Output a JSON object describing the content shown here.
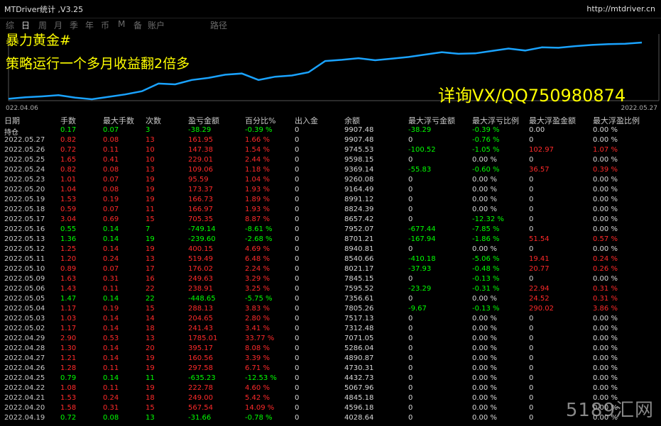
{
  "window": {
    "title": "MTDriver统计 ,V3.25",
    "url": "http://mtdriver.cn"
  },
  "tabs": [
    "综",
    "日",
    "周",
    "月",
    "季",
    "年",
    "币",
    "M",
    "备",
    "账户",
    "路径"
  ],
  "active_tab": 1,
  "chart": {
    "overlay1": "暴力黄金#",
    "overlay2": "策略运行一个多月收益翻2倍多",
    "overlay3": "详询VX/QQ750980874",
    "date_start": "022.04.06",
    "date_end": "2022.05.27",
    "line_color": "#1aa3ff",
    "values": [
      0,
      4,
      6,
      9,
      3,
      -1,
      5,
      11,
      19,
      38,
      36,
      47,
      52,
      60,
      63,
      47,
      55,
      58,
      66,
      94,
      97,
      101,
      96,
      100,
      104,
      110,
      116,
      112,
      113,
      119,
      125,
      120,
      128,
      127,
      131,
      134,
      136,
      137,
      140
    ]
  },
  "table": {
    "headers": [
      "日期",
      "手数",
      "最大手数",
      "次数",
      "盈亏金额",
      "百分比%",
      "出入金",
      "余额",
      "最大浮亏金额",
      "最大浮亏比例",
      "最大浮盈金额",
      "最大浮盈比例"
    ],
    "rows": [
      [
        "持仓",
        "0.17",
        "0.07",
        "3",
        "-38.29",
        "-0.39 %",
        "0",
        "9907.48",
        "-38.29",
        "-0.39 %",
        "0.00",
        "0.00 %"
      ],
      [
        "2022.05.27",
        "0.82",
        "0.08",
        "13",
        "161.95",
        "1.66 %",
        "0",
        "9907.48",
        "0",
        "-0.76 %",
        "0",
        "0.00 %"
      ],
      [
        "2022.05.26",
        "0.72",
        "0.11",
        "10",
        "147.38",
        "1.54 %",
        "0",
        "9745.53",
        "-100.52",
        "-1.05 %",
        "102.97",
        "1.07 %"
      ],
      [
        "2022.05.25",
        "1.65",
        "0.41",
        "10",
        "229.01",
        "2.44 %",
        "0",
        "9598.15",
        "0",
        "0.00 %",
        "0",
        "0.00 %"
      ],
      [
        "2022.05.24",
        "0.82",
        "0.08",
        "13",
        "109.06",
        "1.18 %",
        "0",
        "9369.14",
        "-55.83",
        "-0.60 %",
        "36.57",
        "0.39 %"
      ],
      [
        "2022.05.23",
        "1.01",
        "0.07",
        "19",
        "95.59",
        "1.04 %",
        "0",
        "9260.08",
        "0",
        "0.00 %",
        "0",
        "0.00 %"
      ],
      [
        "2022.05.20",
        "1.04",
        "0.08",
        "19",
        "173.37",
        "1.93 %",
        "0",
        "9164.49",
        "0",
        "0.00 %",
        "0",
        "0.00 %"
      ],
      [
        "2022.05.19",
        "1.53",
        "0.19",
        "19",
        "166.73",
        "1.89 %",
        "0",
        "8991.12",
        "0",
        "0.00 %",
        "0",
        "0.00 %"
      ],
      [
        "2022.05.18",
        "0.59",
        "0.07",
        "11",
        "166.97",
        "1.93 %",
        "0",
        "8824.39",
        "0",
        "0.00 %",
        "0",
        "0.00 %"
      ],
      [
        "2022.05.17",
        "3.04",
        "0.69",
        "15",
        "705.35",
        "8.87 %",
        "0",
        "8657.42",
        "0",
        "-12.32 %",
        "0",
        "0.00 %"
      ],
      [
        "2022.05.16",
        "0.55",
        "0.14",
        "7",
        "-749.14",
        "-8.61 %",
        "0",
        "7952.07",
        "-677.44",
        "-7.85 %",
        "0",
        "0.00 %"
      ],
      [
        "2022.05.13",
        "1.36",
        "0.14",
        "19",
        "-239.60",
        "-2.68 %",
        "0",
        "8701.21",
        "-167.94",
        "-1.86 %",
        "51.54",
        "0.57 %"
      ],
      [
        "2022.05.12",
        "1.25",
        "0.14",
        "19",
        "400.15",
        "4.69 %",
        "0",
        "8940.81",
        "0",
        "0.00 %",
        "0",
        "0.00 %"
      ],
      [
        "2022.05.11",
        "1.20",
        "0.24",
        "13",
        "519.49",
        "6.48 %",
        "0",
        "8540.66",
        "-410.18",
        "-5.06 %",
        "19.41",
        "0.24 %"
      ],
      [
        "2022.05.10",
        "0.89",
        "0.07",
        "17",
        "176.02",
        "2.24 %",
        "0",
        "8021.17",
        "-37.93",
        "-0.48 %",
        "20.77",
        "0.26 %"
      ],
      [
        "2022.05.09",
        "1.63",
        "0.31",
        "16",
        "249.63",
        "3.29 %",
        "0",
        "7845.15",
        "0",
        "-0.13 %",
        "0",
        "0.00 %"
      ],
      [
        "2022.05.06",
        "1.43",
        "0.11",
        "22",
        "238.91",
        "3.25 %",
        "0",
        "7595.52",
        "-23.29",
        "-0.31 %",
        "22.94",
        "0.31 %"
      ],
      [
        "2022.05.05",
        "1.47",
        "0.14",
        "22",
        "-448.65",
        "-5.75 %",
        "0",
        "7356.61",
        "0",
        "0.00 %",
        "24.52",
        "0.31 %"
      ],
      [
        "2022.05.04",
        "1.17",
        "0.19",
        "15",
        "288.13",
        "3.83 %",
        "0",
        "7805.26",
        "-9.67",
        "-0.13 %",
        "290.02",
        "3.86 %"
      ],
      [
        "2022.05.03",
        "1.03",
        "0.14",
        "14",
        "204.65",
        "2.80 %",
        "0",
        "7517.13",
        "0",
        "0.00 %",
        "0",
        "0.00 %"
      ],
      [
        "2022.05.02",
        "1.17",
        "0.14",
        "18",
        "241.43",
        "3.41 %",
        "0",
        "7312.48",
        "0",
        "0.00 %",
        "0",
        "0.00 %"
      ],
      [
        "2022.04.29",
        "2.90",
        "0.53",
        "13",
        "1785.01",
        "33.77 %",
        "0",
        "7071.05",
        "0",
        "0.00 %",
        "0",
        "0.00 %"
      ],
      [
        "2022.04.28",
        "1.30",
        "0.14",
        "20",
        "395.17",
        "8.08 %",
        "0",
        "5286.04",
        "0",
        "0.00 %",
        "0",
        "0.00 %"
      ],
      [
        "2022.04.27",
        "1.21",
        "0.14",
        "19",
        "160.56",
        "3.39 %",
        "0",
        "4890.87",
        "0",
        "0.00 %",
        "0",
        "0.00 %"
      ],
      [
        "2022.04.26",
        "1.28",
        "0.11",
        "19",
        "297.58",
        "6.71 %",
        "0",
        "4730.31",
        "0",
        "0.00 %",
        "0",
        "0.00 %"
      ],
      [
        "2022.04.25",
        "0.79",
        "0.14",
        "11",
        "-635.23",
        "-12.53 %",
        "0",
        "4432.73",
        "0",
        "0.00 %",
        "0",
        "0.00 %"
      ],
      [
        "2022.04.22",
        "1.08",
        "0.11",
        "19",
        "222.78",
        "4.60 %",
        "0",
        "5067.96",
        "0",
        "0.00 %",
        "0",
        "0.00 %"
      ],
      [
        "2022.04.21",
        "1.53",
        "0.24",
        "18",
        "249.00",
        "5.42 %",
        "0",
        "4845.18",
        "0",
        "0.00 %",
        "0",
        "0.00 %"
      ],
      [
        "2022.04.20",
        "1.58",
        "0.31",
        "15",
        "567.54",
        "14.09 %",
        "0",
        "4596.18",
        "0",
        "0.00 %",
        "0",
        "0.00 %"
      ],
      [
        "2022.04.19",
        "0.72",
        "0.08",
        "13",
        "-31.66",
        "-0.78 %",
        "0",
        "4028.64",
        "0",
        "0.00 %",
        "0",
        "0.00 %"
      ]
    ]
  },
  "watermark": "5189汇网"
}
